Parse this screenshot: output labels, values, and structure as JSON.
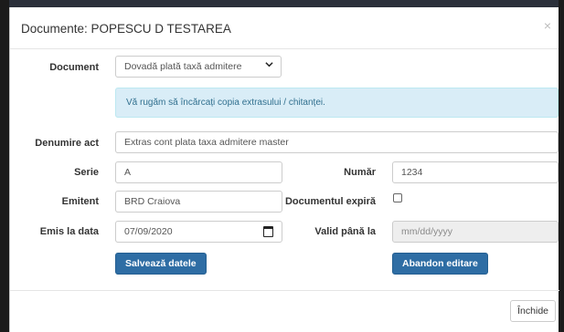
{
  "modal": {
    "title": "Documente: POPESCU D TESTAREA",
    "close_glyph": "×"
  },
  "form": {
    "document": {
      "label": "Document",
      "selected": "Dovadă plată taxă admitere"
    },
    "alert_text": "Vă rugăm să încărcați copia extrasului / chitanței.",
    "denumire": {
      "label": "Denumire act",
      "value": "Extras cont plata taxa admitere master"
    },
    "serie": {
      "label": "Serie",
      "value": "A"
    },
    "numar": {
      "label": "Număr",
      "value": "1234"
    },
    "emitent": {
      "label": "Emitent",
      "value": "BRD Craiova"
    },
    "expira": {
      "label": "Documentul expiră",
      "checked": false
    },
    "emis": {
      "label": "Emis la data",
      "value": "07/09/2020"
    },
    "valid": {
      "label": "Valid până la",
      "placeholder": "mm/dd/yyyy"
    },
    "save_button": "Salvează datele",
    "cancel_button": "Abandon editare"
  },
  "footer": {
    "close_button": "Închide"
  }
}
